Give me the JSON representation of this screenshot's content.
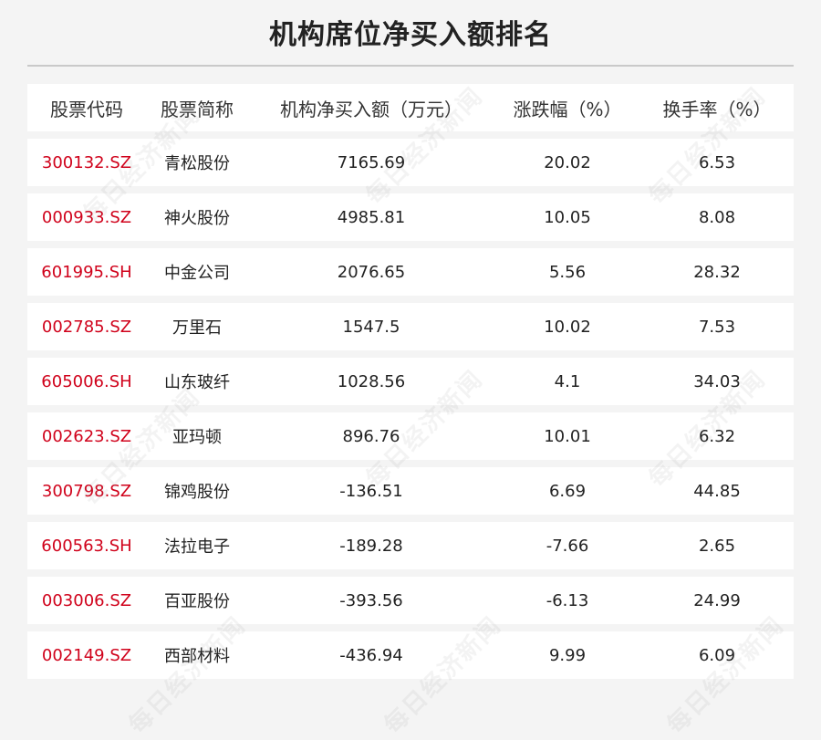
{
  "title": "机构席位净买入额排名",
  "watermark_text": "每日经济新闻",
  "table": {
    "headers": {
      "code": "股票代码",
      "name": "股票简称",
      "net_buy": "机构净买入额（万元）",
      "change": "涨跌幅（%）",
      "turnover": "换手率（%）"
    },
    "rows": [
      {
        "code": "300132.SZ",
        "name": "青松股份",
        "net_buy": "7165.69",
        "change": "20.02",
        "turnover": "6.53"
      },
      {
        "code": "000933.SZ",
        "name": "神火股份",
        "net_buy": "4985.81",
        "change": "10.05",
        "turnover": "8.08"
      },
      {
        "code": "601995.SH",
        "name": "中金公司",
        "net_buy": "2076.65",
        "change": "5.56",
        "turnover": "28.32"
      },
      {
        "code": "002785.SZ",
        "name": "万里石",
        "net_buy": "1547.5",
        "change": "10.02",
        "turnover": "7.53"
      },
      {
        "code": "605006.SH",
        "name": "山东玻纤",
        "net_buy": "1028.56",
        "change": "4.1",
        "turnover": "34.03"
      },
      {
        "code": "002623.SZ",
        "name": "亚玛顿",
        "net_buy": "896.76",
        "change": "10.01",
        "turnover": "6.32"
      },
      {
        "code": "300798.SZ",
        "name": "锦鸡股份",
        "net_buy": "-136.51",
        "change": "6.69",
        "turnover": "44.85"
      },
      {
        "code": "600563.SH",
        "name": "法拉电子",
        "net_buy": "-189.28",
        "change": "-7.66",
        "turnover": "2.65"
      },
      {
        "code": "003006.SZ",
        "name": "百亚股份",
        "net_buy": "-393.56",
        "change": "-6.13",
        "turnover": "24.99"
      },
      {
        "code": "002149.SZ",
        "name": "西部材料",
        "net_buy": "-436.94",
        "change": "9.99",
        "turnover": "6.09"
      }
    ]
  },
  "colors": {
    "stock_code": "#d0021b",
    "background": "#f4f4f4",
    "row": "#ffffff"
  }
}
